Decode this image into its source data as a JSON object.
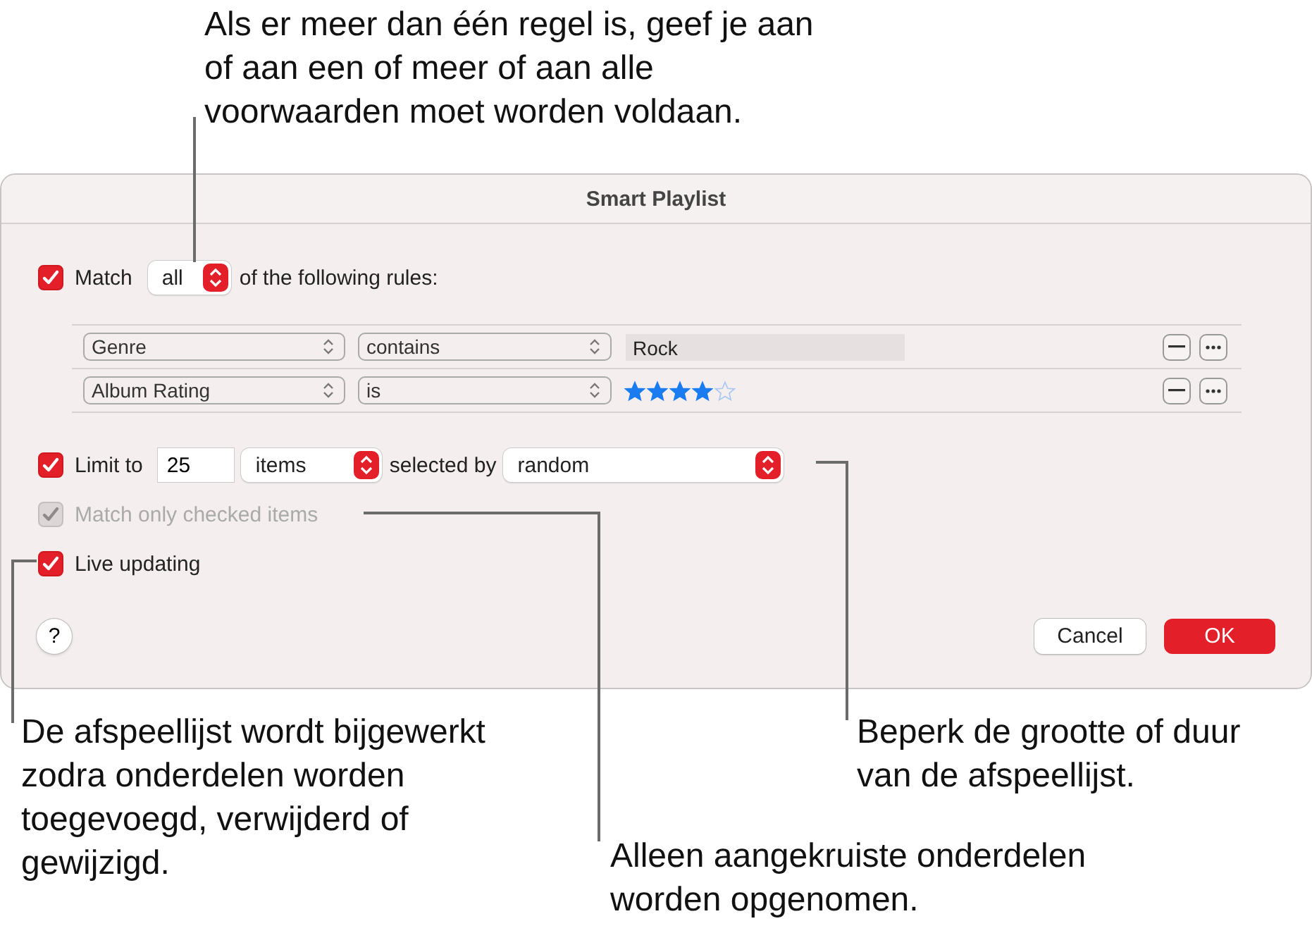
{
  "annotations": {
    "top": "Als er meer dan één regel is, geef je aan of aan een of meer of aan alle voorwaarden moet worden voldaan.",
    "live_updating": "De afspeellijst wordt bijgewerkt zodra onderdelen worden toegevoegd, verwijderd of gewijzigd.",
    "match_only_checked": "Alleen aangekruiste onderdelen worden opgenomen.",
    "limit": "Beperk de grootte of duur van de afspeellijst."
  },
  "dialog": {
    "title": "Smart Playlist",
    "match": {
      "checked": true,
      "label": "Match",
      "quantifier": "all",
      "suffix": "of the following rules:"
    },
    "rules": [
      {
        "kind": "text",
        "field": "Genre",
        "operator": "contains",
        "value": "Rock"
      },
      {
        "kind": "rating",
        "field": "Album Rating",
        "operator": "is",
        "stars": 4
      }
    ],
    "limit": {
      "checked": true,
      "label": "Limit to",
      "amount": "25",
      "unit": "items",
      "selected_by_label": "selected by",
      "selected_by": "random"
    },
    "match_only_checked": {
      "checked": true,
      "disabled": true,
      "label": "Match only checked items"
    },
    "live_updating": {
      "checked": true,
      "label": "Live updating"
    },
    "help": "?",
    "buttons": [
      {
        "kind": "secondary",
        "label": "Cancel"
      },
      {
        "kind": "primary",
        "label": "OK"
      }
    ]
  }
}
